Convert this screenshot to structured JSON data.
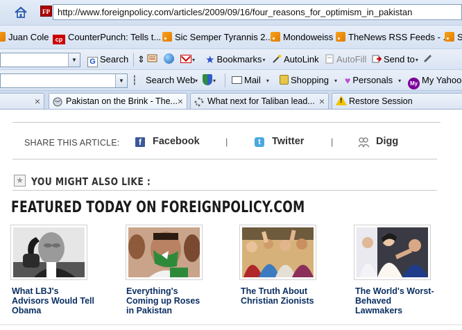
{
  "browser": {
    "favicon_text": "FP",
    "url": "http://www.foreignpolicy.com/articles/2009/09/16/four_reasons_for_optimism_in_pakistan",
    "bookmarks": [
      {
        "label": "Juan Cole",
        "icon": "rss-icon"
      },
      {
        "label": "CounterPunch: Tells t...",
        "icon": "cp-icon"
      },
      {
        "label": "Sic Semper Tyrannis 2...",
        "icon": "rss-icon"
      },
      {
        "label": "Mondoweiss",
        "icon": "rss-icon"
      },
      {
        "label": "TheNews RSS Feeds - ...",
        "icon": "rss-icon"
      },
      {
        "label": "S",
        "icon": "rss-icon"
      }
    ],
    "cp_icon_text": "cp",
    "toolbar1": {
      "search_label": "Search",
      "bookmarks_label": "Bookmarks",
      "autolink_label": "AutoLink",
      "autofill_label": "AutoFill",
      "sendto_label": "Send to"
    },
    "toolbar2": {
      "search_web_label": "Search Web",
      "mail_label": "Mail",
      "shopping_label": "Shopping",
      "personals_label": "Personals",
      "myyahoo_label": "My Yahoo!",
      "yahoo_icon_text": "My"
    },
    "tabs": [
      {
        "label": "Pakistan on the Brink - The...",
        "icon": "globe-icon"
      },
      {
        "label": "What next for Taliban lead...",
        "icon": "loading-icon"
      },
      {
        "label": "Restore Session",
        "icon": "warning-icon"
      }
    ],
    "close_glyph": "×"
  },
  "article": {
    "share_label": "SHARE THIS ARTICLE:",
    "share": {
      "facebook": "Facebook",
      "twitter": "Twitter",
      "digg": "Digg"
    },
    "separator": "|",
    "you_might_also_like": "YOU MIGHT ALSO LIKE :",
    "featured_heading": "FEATURED TODAY ON FOREIGNPOLICY.COM",
    "featured": [
      {
        "caption": "What LBJ's Advisors Would Tell Obama"
      },
      {
        "caption": "Everything's Coming up Roses in Pakistan"
      },
      {
        "caption": "The Truth About Christian Zionists"
      },
      {
        "caption": "The World's Worst-Behaved Lawmakers"
      }
    ]
  },
  "colors": {
    "caption_link": "#0b2f62",
    "facebook_blue": "#3b5998",
    "twitter_blue": "#4aa8df",
    "rss_orange": "#f7a21b"
  }
}
